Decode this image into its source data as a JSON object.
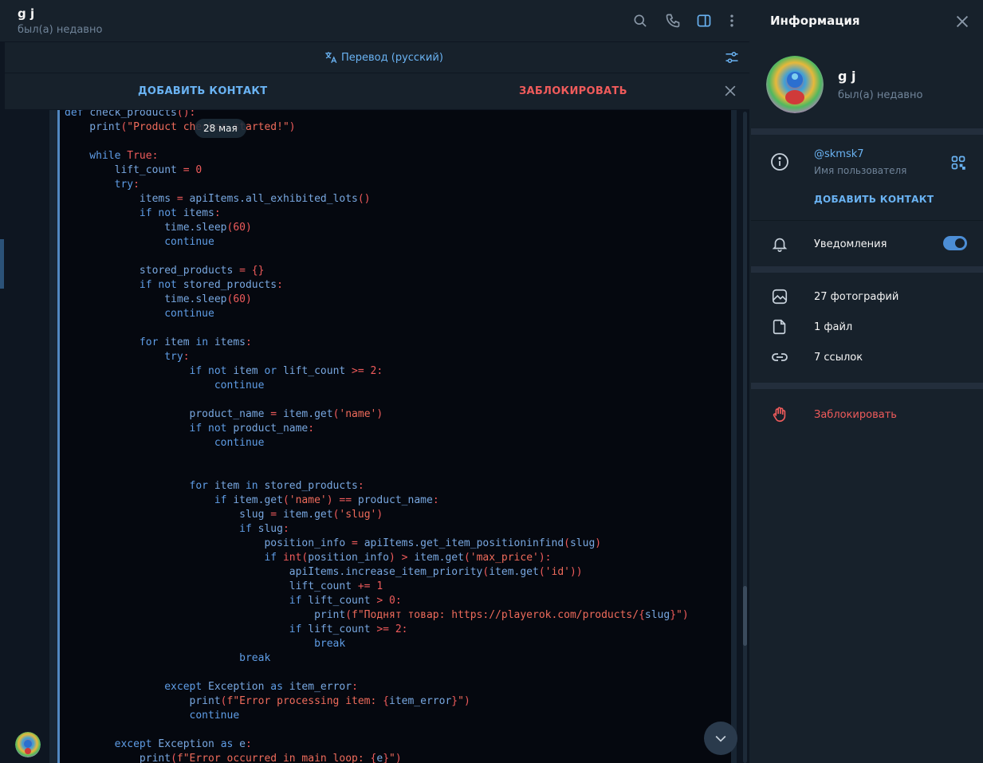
{
  "chat": {
    "title": "g j",
    "status": "был(а) недавно",
    "translate_label": "Перевод (русский)",
    "add_contact": "ДОБАВИТЬ КОНТАКТ",
    "block": "ЗАБЛОКИРОВАТЬ",
    "date_pill": "28 мая"
  },
  "code_lines": [
    [
      {
        "t": "def ",
        "c": "kw"
      },
      {
        "t": "check_products",
        "c": "fn"
      },
      {
        "t": "():",
        "c": "op"
      }
    ],
    [
      {
        "t": "    print",
        "c": "fn"
      },
      {
        "t": "(",
        "c": "op"
      },
      {
        "t": "\"Product checker started!\"",
        "c": "st"
      },
      {
        "t": ")",
        "c": "op"
      }
    ],
    [],
    [
      {
        "t": "    while ",
        "c": "kw"
      },
      {
        "t": "True",
        "c": "op"
      },
      {
        "t": ":",
        "c": "op"
      }
    ],
    [
      {
        "t": "        lift_count ",
        "c": "fn"
      },
      {
        "t": "= ",
        "c": "op"
      },
      {
        "t": "0",
        "c": "op"
      }
    ],
    [
      {
        "t": "        try",
        "c": "kw"
      },
      {
        "t": ":",
        "c": "op"
      }
    ],
    [
      {
        "t": "            items ",
        "c": "fn"
      },
      {
        "t": "= ",
        "c": "op"
      },
      {
        "t": "apiItems.all_exhibited_lots",
        "c": "fn"
      },
      {
        "t": "()",
        "c": "op"
      }
    ],
    [
      {
        "t": "            if not ",
        "c": "kw"
      },
      {
        "t": "items",
        "c": "fn"
      },
      {
        "t": ":",
        "c": "op"
      }
    ],
    [
      {
        "t": "                time.sleep",
        "c": "fn"
      },
      {
        "t": "(60)",
        "c": "op"
      }
    ],
    [
      {
        "t": "                continue",
        "c": "kw"
      }
    ],
    [],
    [
      {
        "t": "            stored_products ",
        "c": "fn"
      },
      {
        "t": "= {}",
        "c": "op"
      }
    ],
    [
      {
        "t": "            if not ",
        "c": "kw"
      },
      {
        "t": "stored_products",
        "c": "fn"
      },
      {
        "t": ":",
        "c": "op"
      }
    ],
    [
      {
        "t": "                time.sleep",
        "c": "fn"
      },
      {
        "t": "(60)",
        "c": "op"
      }
    ],
    [
      {
        "t": "                continue",
        "c": "kw"
      }
    ],
    [],
    [
      {
        "t": "            for ",
        "c": "kw"
      },
      {
        "t": "item ",
        "c": "fn"
      },
      {
        "t": "in ",
        "c": "kw"
      },
      {
        "t": "items",
        "c": "fn"
      },
      {
        "t": ":",
        "c": "op"
      }
    ],
    [
      {
        "t": "                try",
        "c": "kw"
      },
      {
        "t": ":",
        "c": "op"
      }
    ],
    [
      {
        "t": "                    if not ",
        "c": "kw"
      },
      {
        "t": "item ",
        "c": "fn"
      },
      {
        "t": "or ",
        "c": "kw"
      },
      {
        "t": "lift_count ",
        "c": "fn"
      },
      {
        "t": ">= 2:",
        "c": "op"
      }
    ],
    [
      {
        "t": "                        continue",
        "c": "kw"
      }
    ],
    [],
    [
      {
        "t": "                    product_name ",
        "c": "fn"
      },
      {
        "t": "= ",
        "c": "op"
      },
      {
        "t": "item.get",
        "c": "fn"
      },
      {
        "t": "(",
        "c": "op"
      },
      {
        "t": "'name'",
        "c": "st"
      },
      {
        "t": ")",
        "c": "op"
      }
    ],
    [
      {
        "t": "                    if not ",
        "c": "kw"
      },
      {
        "t": "product_name",
        "c": "fn"
      },
      {
        "t": ":",
        "c": "op"
      }
    ],
    [
      {
        "t": "                        continue",
        "c": "kw"
      }
    ],
    [],
    [],
    [
      {
        "t": "                    for ",
        "c": "kw"
      },
      {
        "t": "item ",
        "c": "fn"
      },
      {
        "t": "in ",
        "c": "kw"
      },
      {
        "t": "stored_products",
        "c": "fn"
      },
      {
        "t": ":",
        "c": "op"
      }
    ],
    [
      {
        "t": "                        if ",
        "c": "kw"
      },
      {
        "t": "item.get",
        "c": "fn"
      },
      {
        "t": "(",
        "c": "op"
      },
      {
        "t": "'name'",
        "c": "st"
      },
      {
        "t": ") == ",
        "c": "op"
      },
      {
        "t": "product_name",
        "c": "fn"
      },
      {
        "t": ":",
        "c": "op"
      }
    ],
    [
      {
        "t": "                            slug ",
        "c": "fn"
      },
      {
        "t": "= ",
        "c": "op"
      },
      {
        "t": "item.get",
        "c": "fn"
      },
      {
        "t": "(",
        "c": "op"
      },
      {
        "t": "'slug'",
        "c": "st"
      },
      {
        "t": ")",
        "c": "op"
      }
    ],
    [
      {
        "t": "                            if ",
        "c": "kw"
      },
      {
        "t": "slug",
        "c": "fn"
      },
      {
        "t": ":",
        "c": "op"
      }
    ],
    [
      {
        "t": "                                position_info ",
        "c": "fn"
      },
      {
        "t": "= ",
        "c": "op"
      },
      {
        "t": "apiItems.get_item_positioninfind",
        "c": "fn"
      },
      {
        "t": "(",
        "c": "op"
      },
      {
        "t": "slug",
        "c": "fn"
      },
      {
        "t": ")",
        "c": "op"
      }
    ],
    [
      {
        "t": "                                if ",
        "c": "kw"
      },
      {
        "t": "int",
        "c": "op"
      },
      {
        "t": "(",
        "c": "op"
      },
      {
        "t": "position_info",
        "c": "fn"
      },
      {
        "t": ") > ",
        "c": "op"
      },
      {
        "t": "item.get",
        "c": "fn"
      },
      {
        "t": "(",
        "c": "op"
      },
      {
        "t": "'max_price'",
        "c": "st"
      },
      {
        "t": "):",
        "c": "op"
      }
    ],
    [
      {
        "t": "                                    apiItems.increase_item_priority",
        "c": "fn"
      },
      {
        "t": "(",
        "c": "op"
      },
      {
        "t": "item.get",
        "c": "fn"
      },
      {
        "t": "(",
        "c": "op"
      },
      {
        "t": "'id'",
        "c": "st"
      },
      {
        "t": "))",
        "c": "op"
      }
    ],
    [
      {
        "t": "                                    lift_count ",
        "c": "fn"
      },
      {
        "t": "+= 1",
        "c": "op"
      }
    ],
    [
      {
        "t": "                                    if ",
        "c": "kw"
      },
      {
        "t": "lift_count ",
        "c": "fn"
      },
      {
        "t": "> 0:",
        "c": "op"
      }
    ],
    [
      {
        "t": "                                        print",
        "c": "fn"
      },
      {
        "t": "(",
        "c": "op"
      },
      {
        "t": "f\"Поднят товар: https://playerok.com/products/",
        "c": "st"
      },
      {
        "t": "{",
        "c": "op"
      },
      {
        "t": "slug",
        "c": "fn"
      },
      {
        "t": "}",
        "c": "op"
      },
      {
        "t": "\"",
        "c": "st"
      },
      {
        "t": ")",
        "c": "op"
      }
    ],
    [
      {
        "t": "                                    if ",
        "c": "kw"
      },
      {
        "t": "lift_count ",
        "c": "fn"
      },
      {
        "t": ">= 2:",
        "c": "op"
      }
    ],
    [
      {
        "t": "                                        break",
        "c": "kw"
      }
    ],
    [
      {
        "t": "                            break",
        "c": "kw"
      }
    ],
    [],
    [
      {
        "t": "                except ",
        "c": "kw"
      },
      {
        "t": "Exception ",
        "c": "fn"
      },
      {
        "t": "as ",
        "c": "kw"
      },
      {
        "t": "item_error",
        "c": "fn"
      },
      {
        "t": ":",
        "c": "op"
      }
    ],
    [
      {
        "t": "                    print",
        "c": "fn"
      },
      {
        "t": "(",
        "c": "op"
      },
      {
        "t": "f\"Error processing item: ",
        "c": "st"
      },
      {
        "t": "{",
        "c": "op"
      },
      {
        "t": "item_error",
        "c": "fn"
      },
      {
        "t": "}",
        "c": "op"
      },
      {
        "t": "\"",
        "c": "st"
      },
      {
        "t": ")",
        "c": "op"
      }
    ],
    [
      {
        "t": "                    continue",
        "c": "kw"
      }
    ],
    [],
    [
      {
        "t": "        except ",
        "c": "kw"
      },
      {
        "t": "Exception ",
        "c": "fn"
      },
      {
        "t": "as ",
        "c": "kw"
      },
      {
        "t": "e",
        "c": "fn"
      },
      {
        "t": ":",
        "c": "op"
      }
    ],
    [
      {
        "t": "            print",
        "c": "fn"
      },
      {
        "t": "(",
        "c": "op"
      },
      {
        "t": "f\"Error occurred in main loop: ",
        "c": "st"
      },
      {
        "t": "{",
        "c": "op"
      },
      {
        "t": "e",
        "c": "fn"
      },
      {
        "t": "}",
        "c": "op"
      },
      {
        "t": "\"",
        "c": "st"
      },
      {
        "t": ")",
        "c": "op"
      }
    ]
  ],
  "info": {
    "title": "Информация",
    "name": "g j",
    "status": "был(а) недавно",
    "username": "@skmsk7",
    "username_label": "Имя пользователя",
    "add_contact": "ДОБАВИТЬ КОНТАКТ",
    "notifications": "Уведомления",
    "notifications_on": true,
    "photos": "27 фотографий",
    "files": "1 файл",
    "links": "7 ссылок",
    "block": "Заблокировать"
  },
  "colors": {
    "accent": "#6ab3f3",
    "danger": "#ef5b5b",
    "chat_bg": "#0e1621",
    "panel_bg": "#17212b"
  },
  "icons": [
    "search-icon",
    "phone-icon",
    "sidebar-toggle-icon",
    "more-vertical-icon",
    "translate-icon",
    "translate-settings-icon",
    "close-icon",
    "info-icon",
    "qr-code-icon",
    "bell-icon",
    "photo-icon",
    "file-icon",
    "link-icon",
    "block-hand-icon",
    "chevron-down-icon"
  ]
}
